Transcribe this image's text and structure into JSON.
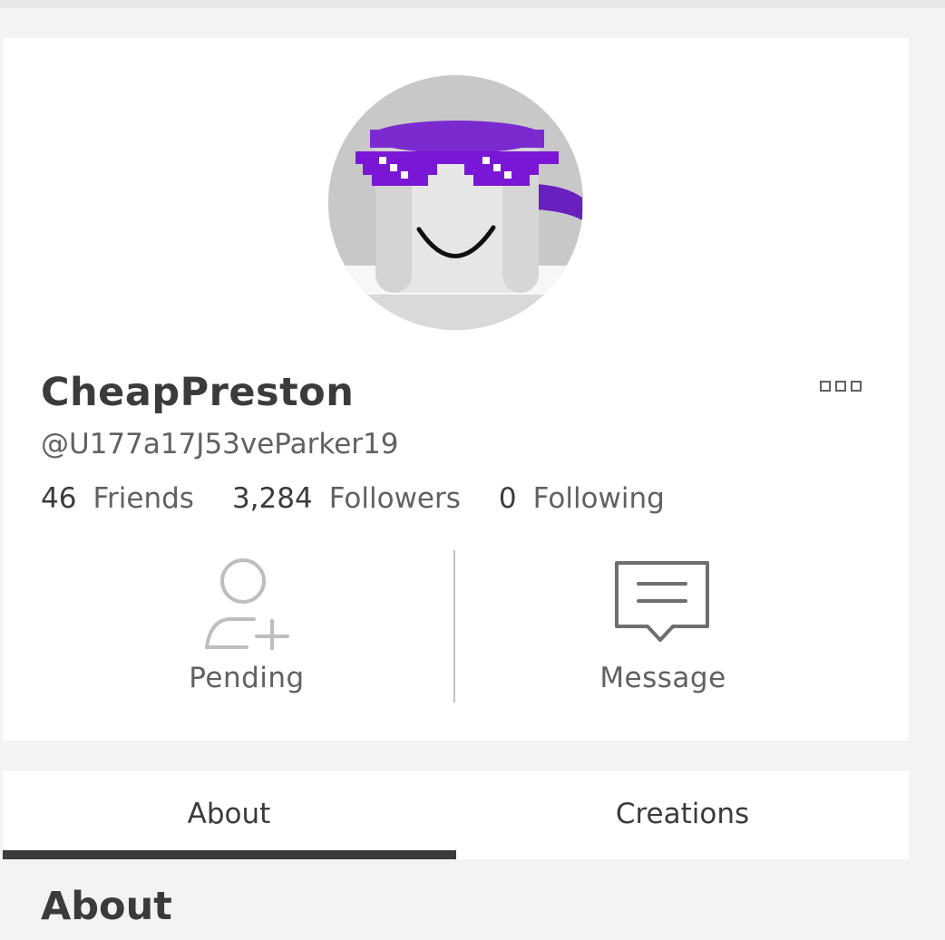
{
  "profile": {
    "display_name": "CheapPreston",
    "username": "@U177a17J53veParker19",
    "avatar_icon": "avatar-headshot-icon",
    "more_icon": "more-options-icon"
  },
  "stats": [
    {
      "count": "46",
      "label": "Friends"
    },
    {
      "count": "3,284",
      "label": "Followers"
    },
    {
      "count": "0",
      "label": "Following"
    }
  ],
  "actions": {
    "pending": {
      "label": "Pending",
      "icon": "add-friend-icon"
    },
    "message": {
      "label": "Message",
      "icon": "message-icon"
    }
  },
  "tabs": [
    {
      "label": "About",
      "active": true
    },
    {
      "label": "Creations",
      "active": false
    }
  ],
  "section": {
    "title": "About"
  },
  "colors": {
    "text_primary": "#393b3d",
    "text_secondary": "#606162",
    "background": "#f2f3f5",
    "accent_purple": "#7a17d6"
  }
}
